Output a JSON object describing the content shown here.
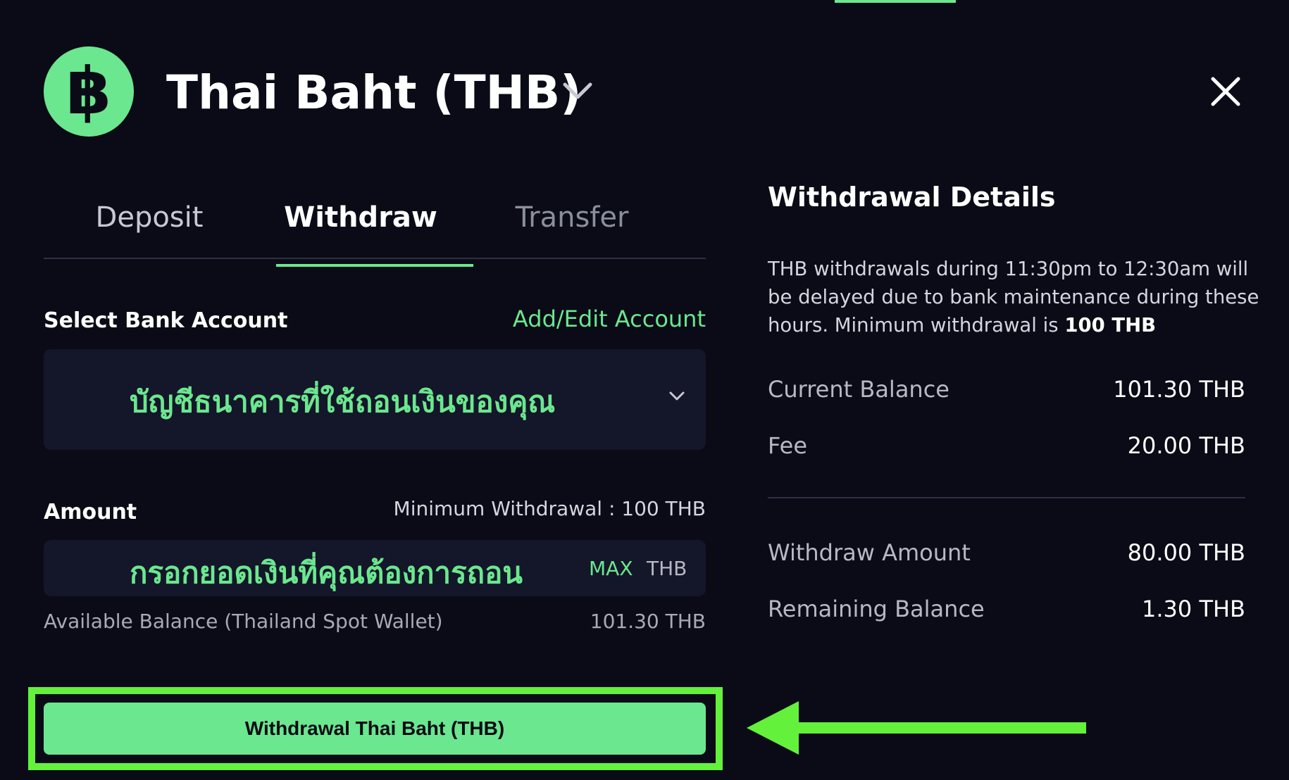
{
  "header": {
    "currency_symbol": "฿",
    "title": "Thai Baht (THB)"
  },
  "tabs": [
    {
      "label": "Deposit"
    },
    {
      "label": "Withdraw",
      "active": true
    },
    {
      "label": "Transfer"
    }
  ],
  "bank": {
    "label": "Select Bank Account",
    "add_edit_link": "Add/Edit Account",
    "selected_text": "บัญชีธนาคารที่ใช้ถอนเงินของคุณ"
  },
  "amount": {
    "label": "Amount",
    "minimum_note": "Minimum Withdrawal : 100 THB",
    "input_text": "กรอกยอดเงินที่คุณต้องการถอน",
    "max_label": "MAX",
    "unit": "THB",
    "available_label": "Available Balance (Thailand Spot Wallet)",
    "available_value": "101.30 THB"
  },
  "submit": {
    "label": "Withdrawal Thai Baht (THB)"
  },
  "details": {
    "title": "Withdrawal Details",
    "notice_text": "THB withdrawals during 11:30pm to 12:30am will be delayed due to bank maintenance during these hours. Minimum withdrawal is ",
    "notice_bold": "100 THB",
    "rows": [
      {
        "label": "Current Balance",
        "value": "101.30 THB"
      },
      {
        "label": "Fee",
        "value": "20.00 THB"
      },
      {
        "label": "Withdraw Amount",
        "value": "80.00 THB"
      },
      {
        "label": "Remaining Balance",
        "value": "1.30 THB"
      }
    ]
  },
  "colors": {
    "background": "#0a0b16",
    "accent_green": "#6be78f",
    "annotation_green": "#63f13c",
    "field_bg": "#141629"
  },
  "icons": {
    "dropdown": "chevron-down-icon",
    "close": "close-icon",
    "annotation": "arrow-left-icon"
  }
}
